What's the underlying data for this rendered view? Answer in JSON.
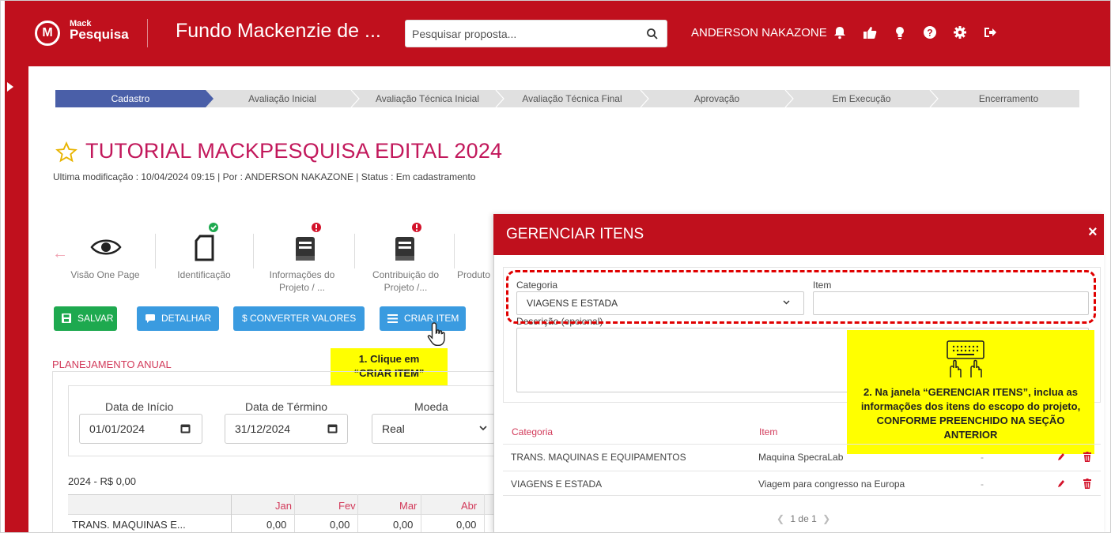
{
  "header": {
    "logo_letter": "M",
    "logo_mack": "Mack",
    "logo_pesquisa": "Pesquisa",
    "title": "Fundo Mackenzie de ...",
    "search_placeholder": "Pesquisar proposta...",
    "user": "ANDERSON NAKAZONE",
    "icons": [
      "bell-icon",
      "thumbs-up-icon",
      "lightbulb-icon",
      "help-icon",
      "gear-icon",
      "logout-icon"
    ]
  },
  "stepper": {
    "steps": [
      "Cadastro",
      "Avaliação Inicial",
      "Avaliação Técnica Inicial",
      "Avaliação Técnica Final",
      "Aprovação",
      "Em Execução",
      "Encerramento"
    ],
    "active_index": 0
  },
  "project": {
    "title": "TUTORIAL MACKPESQUISA EDITAL 2024",
    "meta": "Ultima modificação : 10/04/2024 09:15 | Por : ANDERSON NAKAZONE | Status : Em cadastramento"
  },
  "sections": [
    {
      "label": "Visão One Page",
      "icon": "eye-icon",
      "status": "none"
    },
    {
      "label": "Identificação",
      "icon": "document-icon",
      "status": "complete"
    },
    {
      "label": "Informações do Projeto / ...",
      "icon": "book-icon",
      "status": "error"
    },
    {
      "label": "Contribuição do Projeto /...",
      "icon": "book-icon",
      "status": "error"
    },
    {
      "label": "Produto",
      "icon": "book-icon",
      "status": "none"
    }
  ],
  "buttons": {
    "save": "SALVAR",
    "detail": "DETALHAR",
    "convert": "$ CONVERTER VALORES",
    "create_item": "CRIAR ITEM"
  },
  "planning": {
    "title": "PLANEJAMENTO ANUAL",
    "start_label": "Data de Início",
    "start_value": "01/01/2024",
    "end_label": "Data de Término",
    "end_value": "31/12/2024",
    "currency_label": "Moeda",
    "currency_value": "Real",
    "year_label": "2024 - R$ 0,00",
    "months": [
      "Jan",
      "Fev",
      "Mar",
      "Abr"
    ],
    "row_label": "TRANS. MAQUINAS E...",
    "row_values": [
      "0,00",
      "0,00",
      "0,00",
      "0,00"
    ]
  },
  "tips": {
    "tip1_line1": "1. Clique em",
    "tip1_line2": "“CRIAR ITEM”",
    "tip2": "2. Na janela “GERENCIAR ITENS”, inclua as informações dos itens do escopo do projeto, CONFORME PREENCHIDO NA SEÇÃO ANTERIOR"
  },
  "modal": {
    "title": "GERENCIAR ITENS",
    "close": "×",
    "category_label": "Categoria",
    "category_value": "VIAGENS E ESTADA",
    "item_label": "Item",
    "description_label": "Descrição (opcional)",
    "table_headers": [
      "Categoria",
      "Item"
    ],
    "rows": [
      {
        "category": "TRANS. MAQUINAS E EQUIPAMENTOS",
        "item": "Maquina SpecraLab",
        "value": "-"
      },
      {
        "category": "VIAGENS E ESTADA",
        "item": "Viagem para congresso na Europa",
        "value": "-"
      }
    ],
    "pager": "1 de 1"
  },
  "colors": {
    "brand_red": "#c0101d",
    "title_pink": "#c2185b",
    "active_step": "#4a5fa8",
    "green": "#1ea94f",
    "blue": "#3a9be0",
    "highlight": "#ffff00"
  }
}
